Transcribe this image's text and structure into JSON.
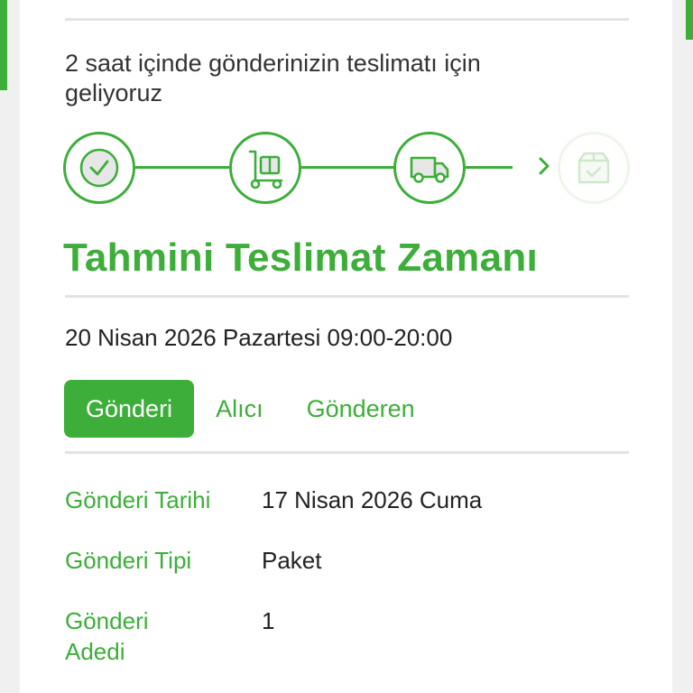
{
  "colors": {
    "accent": "#3cae39",
    "accent_faded": "#cfe8cc",
    "divider": "#e3e3e3",
    "text": "#222222"
  },
  "status": {
    "message": "2 saat içinde gönderinizin teslimatı için geliyoruz"
  },
  "tracker": {
    "steps": [
      {
        "icon": "check-box-icon",
        "state": "done"
      },
      {
        "icon": "hand-truck-icon",
        "state": "done"
      },
      {
        "icon": "delivery-truck-icon",
        "state": "active"
      },
      {
        "icon": "package-check-icon",
        "state": "pending"
      }
    ],
    "next_indicator_icon": "chevron-right-icon"
  },
  "delivery": {
    "title": "Tahmini Teslimat Zamanı",
    "estimate": "20 Nisan 2026 Pazartesi 09:00-20:00"
  },
  "tabs": [
    {
      "label": "Gönderi",
      "active": true
    },
    {
      "label": "Alıcı",
      "active": false
    },
    {
      "label": "Gönderen",
      "active": false
    }
  ],
  "shipment": {
    "rows": [
      {
        "label": "Gönderi Tarihi",
        "value": "17 Nisan 2026 Cuma"
      },
      {
        "label": "Gönderi Tipi",
        "value": "Paket"
      },
      {
        "label": "Gönderi Adedi",
        "value": "1"
      }
    ]
  }
}
